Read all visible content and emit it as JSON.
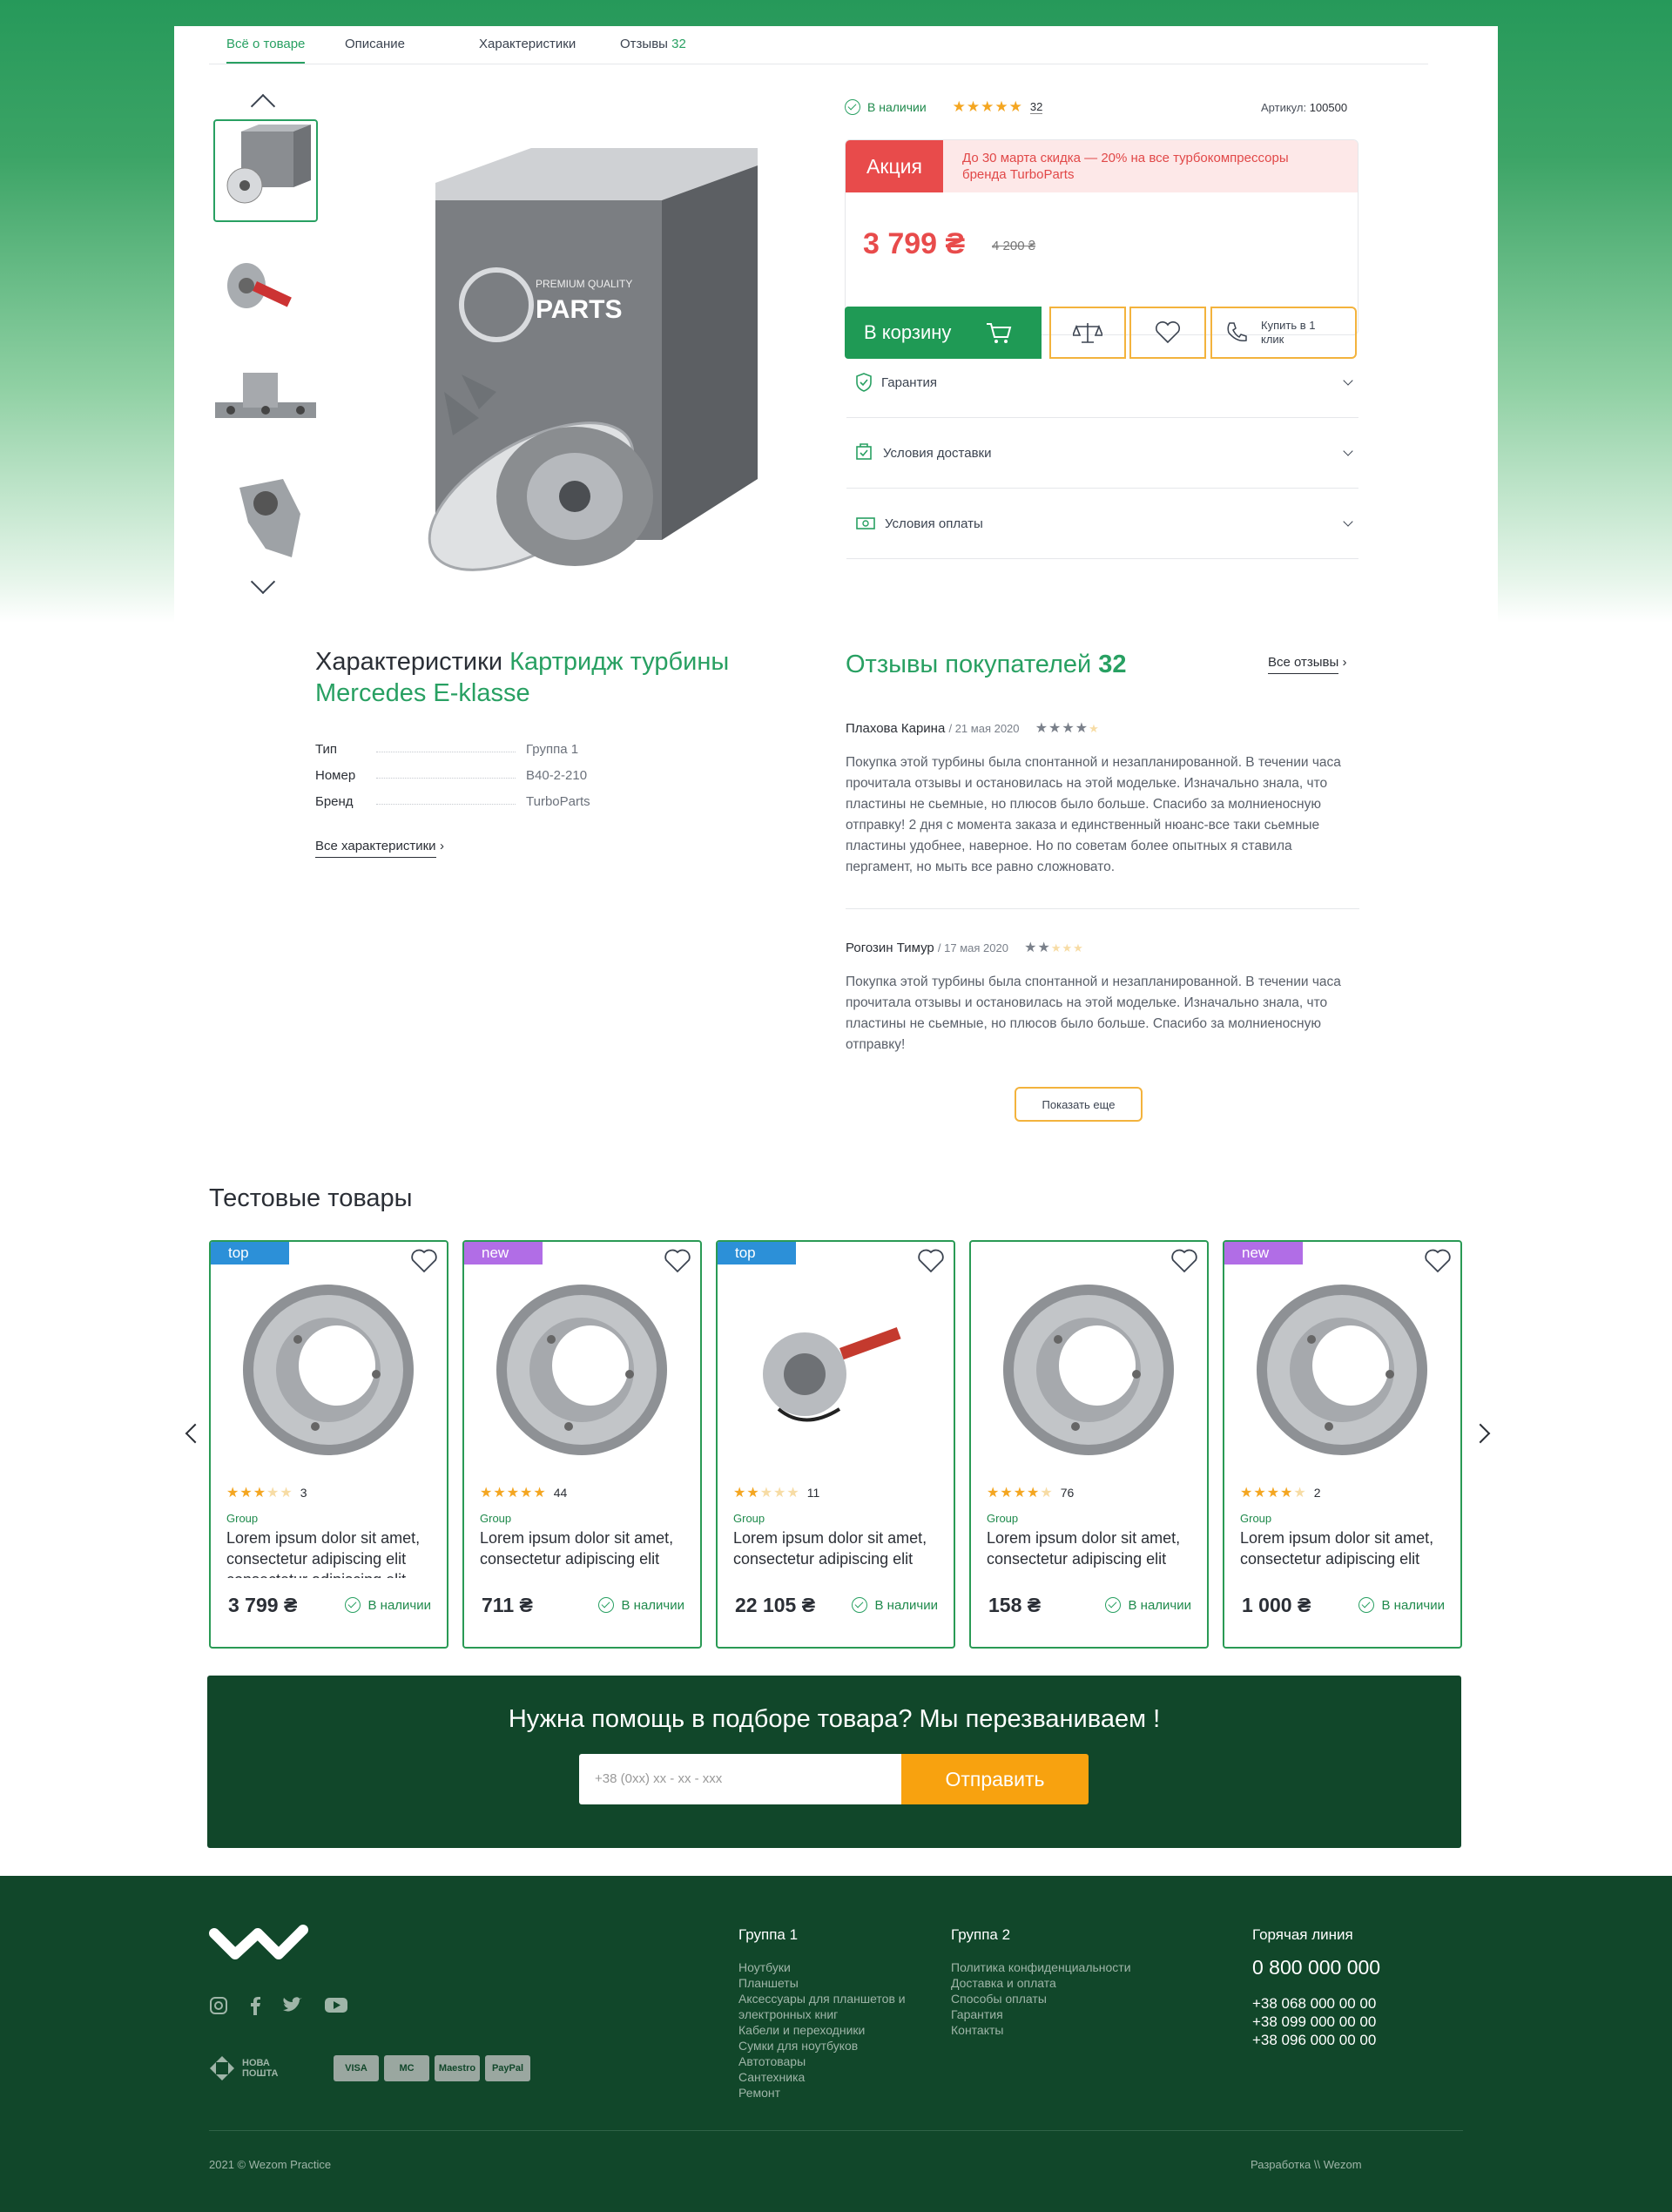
{
  "tabs": {
    "all": "Всё о товаре",
    "desc": "Описание",
    "specs": "Характеристики",
    "reviews": "Отзывы",
    "reviews_count": "32"
  },
  "product": {
    "stock": "В наличии",
    "rating": 5,
    "reviews_count": "32",
    "article_label": "Артикул:",
    "article": "100500",
    "promo_label": "Акция",
    "promo_text": "До 30 марта скидка — 20% на все турбокомпрессоры бренда TurboParts",
    "price": "3 799 ₴",
    "old_price": "4 200 ₴",
    "cart": "В корзину",
    "one_click": "Купить в 1 клик",
    "image_text": "PARTS",
    "image_subtext": "PREMIUM QUALITY"
  },
  "accordion": {
    "warranty": "Гарантия",
    "delivery": "Условия доставки",
    "payment": "Условия оплаты"
  },
  "specs": {
    "title": "Характеристики",
    "title_accent": "Картридж турбины Mercedes E-klasse",
    "rows": [
      {
        "k": "Тип",
        "v": "Группа 1"
      },
      {
        "k": "Номер",
        "v": "В40-2-210"
      },
      {
        "k": "Бренд",
        "v": "TurboParts"
      }
    ],
    "all": "Все характеристики"
  },
  "reviews": {
    "title": "Отзывы покупателей",
    "count": "32",
    "all": "Все отзывы",
    "more": "Показать еще",
    "items": [
      {
        "author": "Плахова Карина",
        "date": "21 мая 2020",
        "rating": 4,
        "text": "Покупка этой турбины была спонтанной и незапланированной. В течении часа прочитала отзывы и остановилась на этой модельке. Изначально знала, что пластины не сьемные, но плюсов было больше. Спасибо за молниеносную отправку! 2 дня с момента заказа и единственный нюанс-все таки сьемные пластины удобнее, наверное. Но по советам более опытных я ставила пергамент, но мыть все равно сложновато."
      },
      {
        "author": "Рогозин Тимур",
        "date": "17 мая 2020",
        "rating": 2,
        "text": "Покупка этой турбины была спонтанной и незапланированной. В течении часа прочитала отзывы и остановилась на этой модельке. Изначально знала, что пластины не сьемные, но плюсов было больше. Спасибо за молниеносную отправку!"
      }
    ]
  },
  "products": {
    "title": "Тестовые товары",
    "items": [
      {
        "badge": "top",
        "rating": 3,
        "count": "3",
        "group": "Group",
        "title": "Lorem ipsum dolor sit amet, consectetur adipiscing elit consectetur adipiscing elit",
        "price": "3 799 ₴",
        "stock": "В наличии"
      },
      {
        "badge": "new",
        "rating": 5,
        "count": "44",
        "group": "Group",
        "title": "Lorem ipsum dolor sit amet, consectetur adipiscing elit",
        "price": "711 ₴",
        "stock": "В наличии"
      },
      {
        "badge": "top",
        "rating": 2,
        "count": "11",
        "group": "Group",
        "title": "Lorem ipsum dolor sit amet, consectetur adipiscing elit",
        "price": "22 105 ₴",
        "stock": "В наличии"
      },
      {
        "badge": "",
        "rating": 4,
        "count": "76",
        "group": "Group",
        "title": "Lorem ipsum dolor sit amet, consectetur adipiscing elit",
        "price": "158 ₴",
        "stock": "В наличии"
      },
      {
        "badge": "new",
        "rating": 4,
        "count": "2",
        "group": "Group",
        "title": "Lorem ipsum dolor sit amet, consectetur adipiscing elit",
        "price": "1 000 ₴",
        "stock": "В наличии"
      }
    ]
  },
  "callback": {
    "title": "Нужна помощь в подборе товара? Мы перезваниваем !",
    "placeholder": "+38 (0xx) xx - xx - xxx",
    "send": "Отправить"
  },
  "footer": {
    "group1": "Группа 1",
    "group1_links": [
      "Ноутбуки",
      "Планшеты",
      "Аксессуары для планшетов и электронных книг",
      "Кабели и переходники",
      "Сумки для ноутбуков",
      "Автотовары",
      "Сантехника",
      "Ремонт"
    ],
    "group2": "Группа 2",
    "group2_links": [
      "Политика конфиденциальности",
      "Доставка и оплата",
      "Способы оплаты",
      "Гарантия",
      "Контакты"
    ],
    "hotline": "Горячая линия",
    "hotline_number": "0 800 000 000",
    "phones": [
      "+38 068 000 00 00",
      "+38 099 000 00 00",
      "+38 096 000 00 00"
    ],
    "nova": "НОВА ПОШТА",
    "payments": [
      "VISA",
      "MC",
      "Maestro",
      "PayPal"
    ],
    "copyright": "2021 © Wezom Practice",
    "dev": "Разработка \\\\ Wezom"
  }
}
